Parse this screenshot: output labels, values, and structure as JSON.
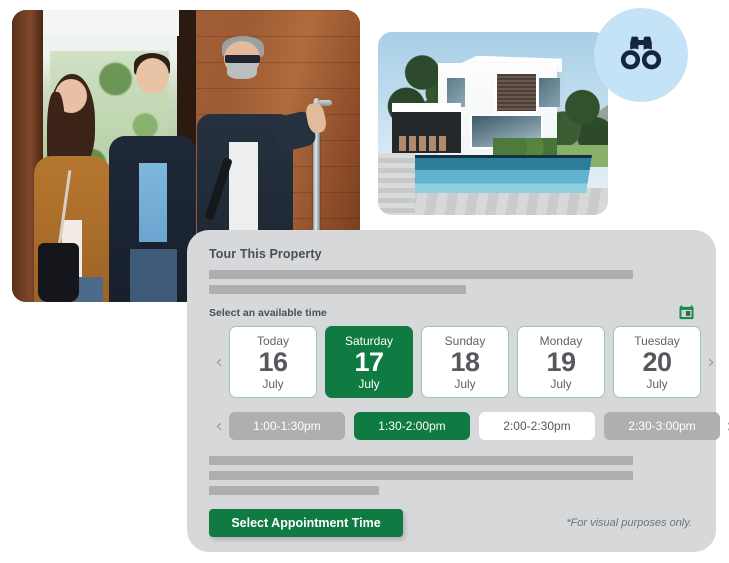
{
  "photos": {
    "people_alt": "real-estate-agent-showing-home-to-couple",
    "house_alt": "modern-white-house-with-pool"
  },
  "badge": {
    "icon": "binoculars-icon",
    "circle_color": "#c5e3f7",
    "icon_color": "#13253f"
  },
  "card": {
    "title": "Tour This Property",
    "background_color": "#d6d8da",
    "subheading": "Select an available time",
    "calendar_icon": "calendar-icon",
    "calendar_icon_color": "#1b8a4b",
    "prev_chevron": "‹",
    "next_chevron": "›",
    "accent_color": "#0f7b43",
    "dates": [
      {
        "dow": "Today",
        "day": "16",
        "month": "July",
        "state": "available"
      },
      {
        "dow": "Saturday",
        "day": "17",
        "month": "July",
        "state": "selected"
      },
      {
        "dow": "Sunday",
        "day": "18",
        "month": "July",
        "state": "available"
      },
      {
        "dow": "Monday",
        "day": "19",
        "month": "July",
        "state": "available"
      },
      {
        "dow": "Tuesday",
        "day": "20",
        "month": "July",
        "state": "available"
      }
    ],
    "times": [
      {
        "label": "1:00-1:30pm",
        "state": "disabled"
      },
      {
        "label": "1:30-2:00pm",
        "state": "selected"
      },
      {
        "label": "2:00-2:30pm",
        "state": "available"
      },
      {
        "label": "2:30-3:00pm",
        "state": "disabled"
      }
    ],
    "cta_label": "Select Appointment Time",
    "disclaimer": "*For visual purposes only."
  }
}
